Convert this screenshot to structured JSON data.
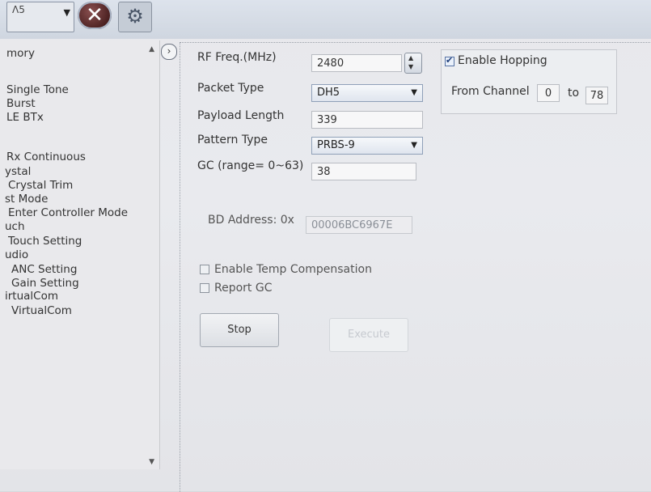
{
  "toolbar": {
    "combo_text": "Λ5",
    "close_icon": "close-icon",
    "settings_icon": "gear-icon"
  },
  "sidebar": {
    "items": [
      {
        "label": "mory"
      },
      {
        "label": "Single Tone"
      },
      {
        "label": "Burst"
      },
      {
        "label": "LE BTx"
      },
      {
        "label": "Rx Continuous"
      },
      {
        "label": "ystal"
      },
      {
        "label": "Crystal Trim"
      },
      {
        "label": "st Mode"
      },
      {
        "label": "Enter Controller Mode"
      },
      {
        "label": "uch"
      },
      {
        "label": "Touch Setting"
      },
      {
        "label": "udio"
      },
      {
        "label": "ANC Setting"
      },
      {
        "label": "Gain Setting"
      },
      {
        "label": "irtualCom"
      },
      {
        "label": "VirtualCom"
      }
    ]
  },
  "form": {
    "rf_freq_label": "RF Freq.(MHz)",
    "rf_freq_value": "2480",
    "packet_type_label": "Packet Type",
    "packet_type_value": "DH5",
    "payload_length_label": "Payload Length",
    "payload_length_value": "339",
    "pattern_type_label": "Pattern Type",
    "pattern_type_value": "PRBS-9",
    "gc_label": "GC (range= 0~63)",
    "gc_value": "38",
    "bd_address_label": "BD Address: 0x",
    "bd_address_value": "00006BC6967E",
    "enable_temp_label": "Enable Temp Compensation",
    "report_gc_label": "Report GC",
    "stop_label": "Stop",
    "execute_label": "Execute"
  },
  "hopping": {
    "enable_label": "Enable Hopping",
    "enabled": true,
    "from_label": "From Channel",
    "from_value": "0",
    "to_label": "to",
    "to_value": "78"
  }
}
